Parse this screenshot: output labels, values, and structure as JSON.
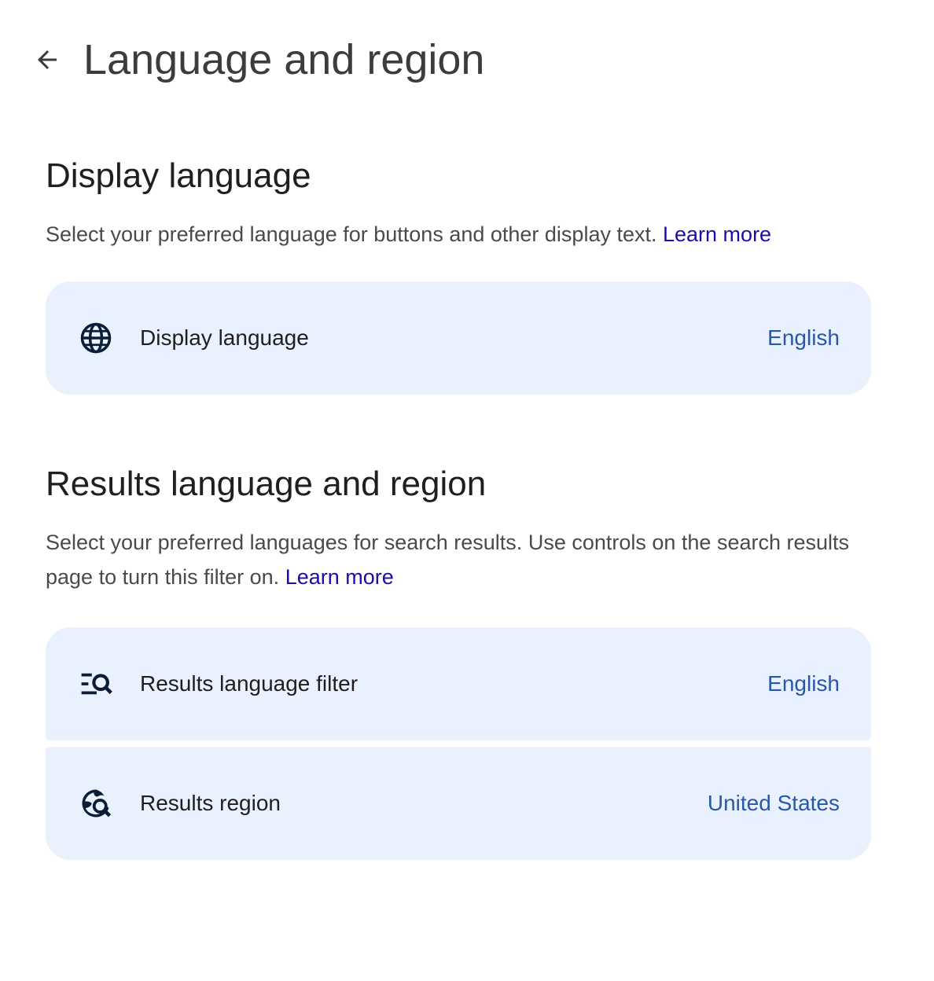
{
  "header": {
    "back_icon": "arrow-left-icon",
    "title": "Language and region"
  },
  "display_section": {
    "heading": "Display language",
    "description": "Select your preferred language for buttons and other display text.",
    "learn_more": "Learn more",
    "items": [
      {
        "icon": "globe-icon",
        "label": "Display language",
        "value": "English"
      }
    ]
  },
  "results_section": {
    "heading": "Results language and region",
    "description": "Select your preferred languages for search results. Use controls on the search results page to turn this filter on.",
    "learn_more": "Learn more",
    "items": [
      {
        "icon": "filter-search-icon",
        "label": "Results language filter",
        "value": "English"
      },
      {
        "icon": "globe-search-icon",
        "label": "Results region",
        "value": "United States"
      }
    ]
  },
  "colors": {
    "card_background": "#e9f0fe",
    "value_text": "#2a58a8",
    "link": "#1a0dab",
    "icon": "#0b1d36"
  }
}
